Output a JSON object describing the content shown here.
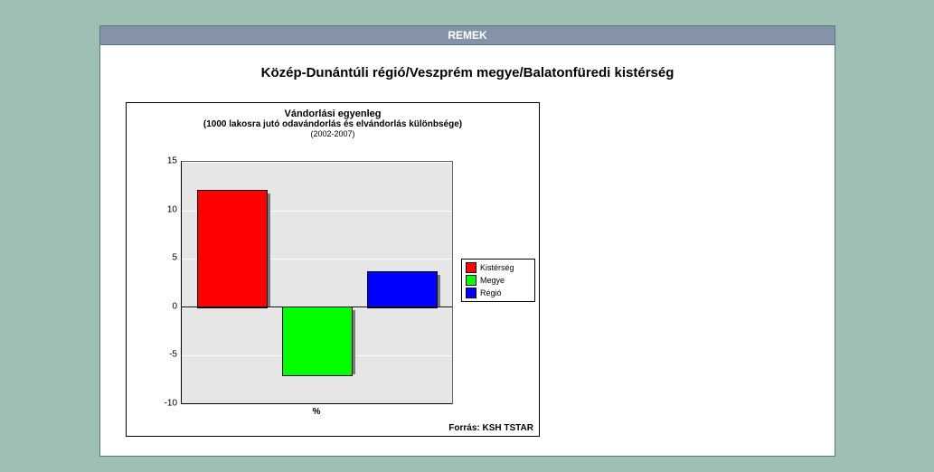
{
  "header": {
    "title": "REMEK"
  },
  "breadcrumb": "Közép-Dunántúli régió/Veszprém megye/Balatonfüredi kistérség",
  "chart_data": {
    "type": "bar",
    "title": "Vándorlási egyenleg",
    "subtitle": "(1000 lakosra jutó odavándorlás és elvándorlás különbsége)",
    "period": "(2002-2007)",
    "categories": [
      "Kistérség",
      "Megye",
      "Régió"
    ],
    "values": [
      12,
      -7,
      3.6
    ],
    "colors": [
      "#ff0000",
      "#00ff00",
      "#0000ff"
    ],
    "xlabel": "%",
    "ylabel": "",
    "ylim": [
      -10,
      15
    ],
    "yticks": [
      -10,
      -5,
      0,
      5,
      10,
      15
    ],
    "source": "Forrás: KSH TSTAR",
    "legend": [
      {
        "label": "Kistérség",
        "color": "#ff0000"
      },
      {
        "label": "Megye",
        "color": "#00ff00"
      },
      {
        "label": "Régió",
        "color": "#0000ff"
      }
    ]
  }
}
